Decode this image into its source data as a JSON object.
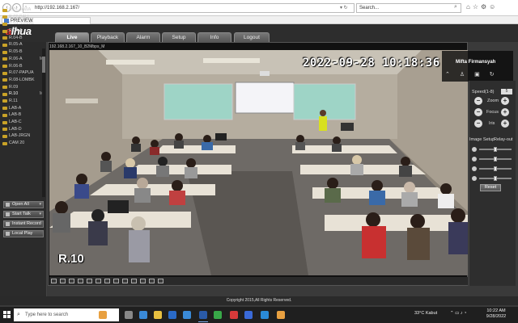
{
  "browser": {
    "url": "http://192.168.2.167/",
    "search_placeholder": "Search...",
    "tab_title": "PREVIEW"
  },
  "app": {
    "logo_text": "a",
    "logo_rest": "lhua",
    "nav_tabs": [
      {
        "label": "Live",
        "active": true
      },
      {
        "label": "Playback",
        "active": false
      },
      {
        "label": "Alarm",
        "active": false
      },
      {
        "label": "Setup",
        "active": false
      },
      {
        "label": "Info",
        "active": false
      },
      {
        "label": "Logout",
        "active": false
      }
    ]
  },
  "camera_list": [
    {
      "label": "R.01-JAWA",
      "marker": ""
    },
    {
      "label": "R.02-BALI",
      "marker": ""
    },
    {
      "label": "R.03-SUMA1",
      "marker": ""
    },
    {
      "label": "R.04-A",
      "marker": ""
    },
    {
      "label": "R.04-B",
      "marker": ""
    },
    {
      "label": "R.05-A",
      "marker": ""
    },
    {
      "label": "R.05-B",
      "marker": ""
    },
    {
      "label": "R.06-A",
      "marker": "M"
    },
    {
      "label": "R.06-B",
      "marker": ""
    },
    {
      "label": "R.07-PAPUA",
      "marker": ""
    },
    {
      "label": "R.08-LOMBK",
      "marker": ""
    },
    {
      "label": "R.09",
      "marker": ""
    },
    {
      "label": "R.10",
      "marker": "M",
      "selected": true
    },
    {
      "label": "R.11",
      "marker": ""
    },
    {
      "label": "LAB-A",
      "marker": ""
    },
    {
      "label": "LAB-B",
      "marker": ""
    },
    {
      "label": "LAB-C",
      "marker": ""
    },
    {
      "label": "LAB-D",
      "marker": ""
    },
    {
      "label": "LAB-JRGN",
      "marker": ""
    },
    {
      "label": "CAM 20",
      "marker": ""
    }
  ],
  "side_buttons": {
    "open_all": "Open All",
    "start_talk": "Start Talk",
    "instant_record": "Instant Record",
    "local_play": "Local Play"
  },
  "video": {
    "info_text": "192.168.2.167_10_B2Mbps_M",
    "timestamp": "2022-09-28 10:18:36",
    "camera_label": "R.10",
    "user_name": "Mifta Firmansyah"
  },
  "ptz": {
    "speed_label": "Speed(1-8)",
    "speed_value": "5",
    "zoom_label": "Zoom",
    "focus_label": "Focus",
    "iris_label": "Iris",
    "image_setup_label": "Image Setup",
    "relay_out_label": "Relay-out",
    "reset_label": "Reset"
  },
  "image_sliders": [
    {
      "name": "brightness",
      "value": 50
    },
    {
      "name": "contrast",
      "value": 50
    },
    {
      "name": "saturation",
      "value": 50
    },
    {
      "name": "hue",
      "value": 50
    }
  ],
  "footer": {
    "copyright": "Copyright 2015,All Rights Reserved."
  },
  "taskbar": {
    "search_placeholder": "Type here to search",
    "weather": "33°C  Kabut",
    "time": "10:22 AM",
    "date": "9/28/2022"
  },
  "colors": {
    "accent_red": "#e03030",
    "camera_icon": "#c9a227",
    "taskbar": "#1f1f1f"
  }
}
